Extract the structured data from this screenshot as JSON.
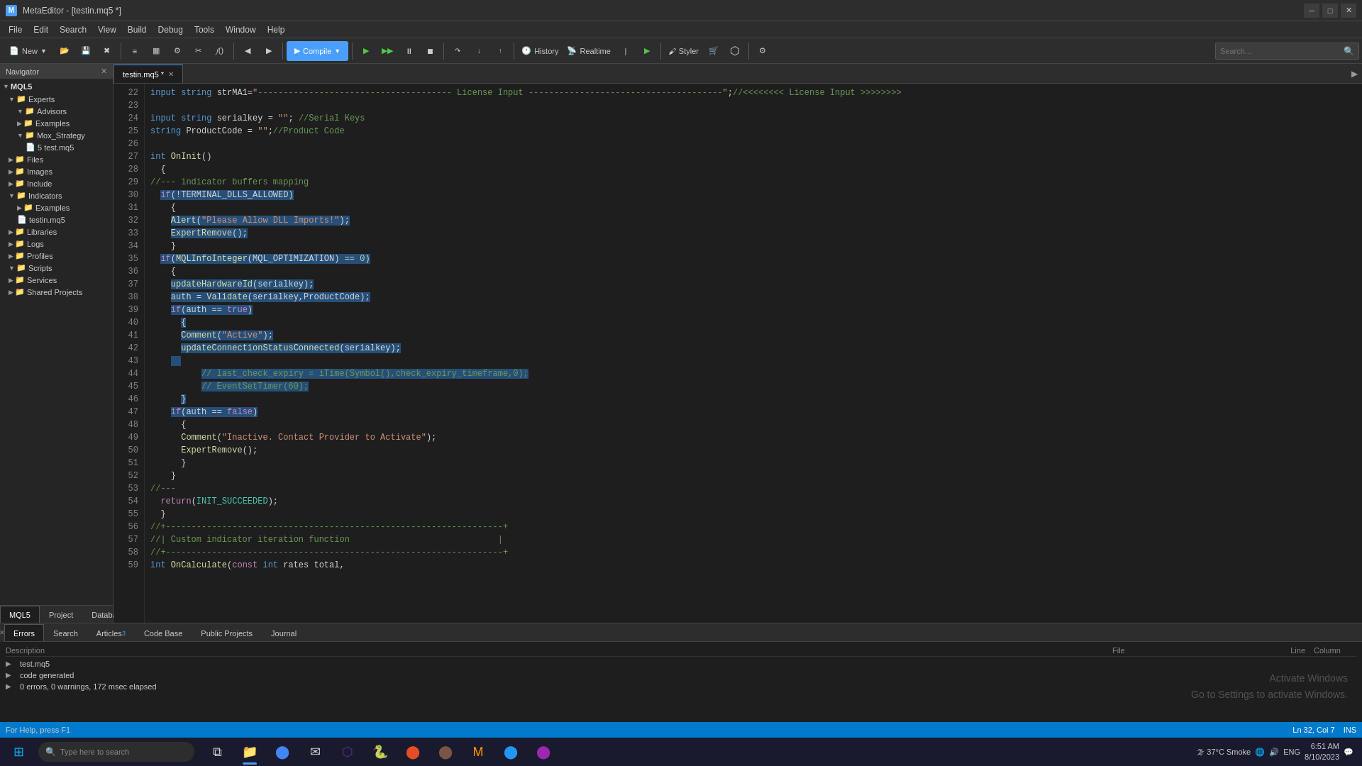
{
  "title_bar": {
    "title": "MetaEditor - [testin.mq5 *]",
    "icon": "M"
  },
  "menu": {
    "items": [
      "File",
      "Edit",
      "View",
      "Build",
      "Debug",
      "Tools",
      "Window",
      "Help"
    ]
  },
  "toolbar": {
    "new_label": "New",
    "compile_label": "Compile",
    "history_label": "History",
    "realtime_label": "Realtime",
    "styler_label": "Styler"
  },
  "tab": {
    "filename": "testin.mq5",
    "modified": true
  },
  "navigator": {
    "title": "Navigator",
    "root": "MQL5",
    "items": [
      {
        "label": "Experts",
        "type": "folder",
        "level": 1,
        "expanded": true
      },
      {
        "label": "Advisors",
        "type": "folder",
        "level": 2,
        "expanded": true
      },
      {
        "label": "Examples",
        "type": "folder",
        "level": 2,
        "expanded": false
      },
      {
        "label": "Mox_Strategy",
        "type": "folder",
        "level": 2,
        "expanded": true
      },
      {
        "label": "5   test.mq5",
        "type": "file",
        "level": 3
      },
      {
        "label": "Files",
        "type": "folder",
        "level": 1,
        "expanded": false
      },
      {
        "label": "Images",
        "type": "folder",
        "level": 1,
        "expanded": false
      },
      {
        "label": "Include",
        "type": "folder",
        "level": 1,
        "expanded": false
      },
      {
        "label": "Indicators",
        "type": "folder",
        "level": 1,
        "expanded": true
      },
      {
        "label": "Examples",
        "type": "folder",
        "level": 2,
        "expanded": false
      },
      {
        "label": "testin.mq5",
        "type": "file",
        "level": 2
      },
      {
        "label": "Libraries",
        "type": "folder",
        "level": 1,
        "expanded": false
      },
      {
        "label": "Logs",
        "type": "folder",
        "level": 1,
        "expanded": false
      },
      {
        "label": "Profiles",
        "type": "folder",
        "level": 1,
        "expanded": false
      },
      {
        "label": "Scripts",
        "type": "folder",
        "level": 1,
        "expanded": false
      },
      {
        "label": "Services",
        "type": "folder",
        "level": 1,
        "expanded": false
      },
      {
        "label": "Shared Projects",
        "type": "folder",
        "level": 1,
        "expanded": false
      }
    ]
  },
  "bottom_tabs": [
    "Errors",
    "Search",
    "Articles",
    "Code Base",
    "Public Projects",
    "Journal"
  ],
  "bottom_log": {
    "header": {
      "description": "Description",
      "file": "File",
      "line": "Line",
      "column": "Column"
    },
    "entries": [
      {
        "arrow": "▶",
        "desc": "test.mq5",
        "file": "",
        "line": "",
        "col": ""
      },
      {
        "arrow": "▶",
        "desc": "code generated",
        "file": "",
        "line": "",
        "col": ""
      },
      {
        "arrow": "▶",
        "desc": "0 errors, 0 warnings, 172 msec elapsed",
        "file": "",
        "line": "",
        "col": ""
      }
    ]
  },
  "status_bar": {
    "help_text": "For Help, press F1",
    "position": "Ln 32, Col 7",
    "encoding": "INS"
  },
  "taskbar": {
    "search_placeholder": "Type here to search",
    "search_label": "Search",
    "time": "6:51 AM",
    "date": "8/10/2023",
    "weather": "37°C  Smoke",
    "layout": "ENG"
  },
  "activate_windows": {
    "line1": "Activate Windows",
    "line2": "Go to Settings to activate Windows."
  }
}
